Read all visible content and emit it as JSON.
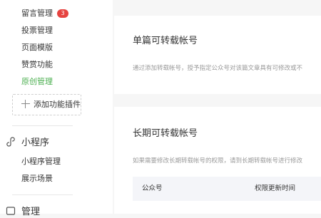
{
  "sidebar": {
    "items_top": [
      {
        "label": "留言管理",
        "badge": "3"
      },
      {
        "label": "投票管理"
      },
      {
        "label": "页面模版"
      },
      {
        "label": "赞赏功能"
      },
      {
        "label": "原创管理",
        "active": true
      }
    ],
    "add_plugin_label": "添加功能插件",
    "miniprogram": {
      "title": "小程序",
      "items": [
        "小程序管理",
        "展示场景"
      ]
    },
    "manage": {
      "title": "管理"
    }
  },
  "panels": {
    "single": {
      "title": "单篇可转载帐号",
      "desc": "通过添加转载帐号，授予指定公众号对该篇文章具有可修改或不"
    },
    "long": {
      "title": "长期可转载帐号",
      "desc": "如果需要修改长期转载帐号的权限，请到长期转载帐号进行修改",
      "table_headers": [
        "公众号",
        "权限更新时间"
      ]
    }
  },
  "colors": {
    "active": "#4caf50",
    "badge": "#e64340",
    "accent_text": "#353535"
  }
}
